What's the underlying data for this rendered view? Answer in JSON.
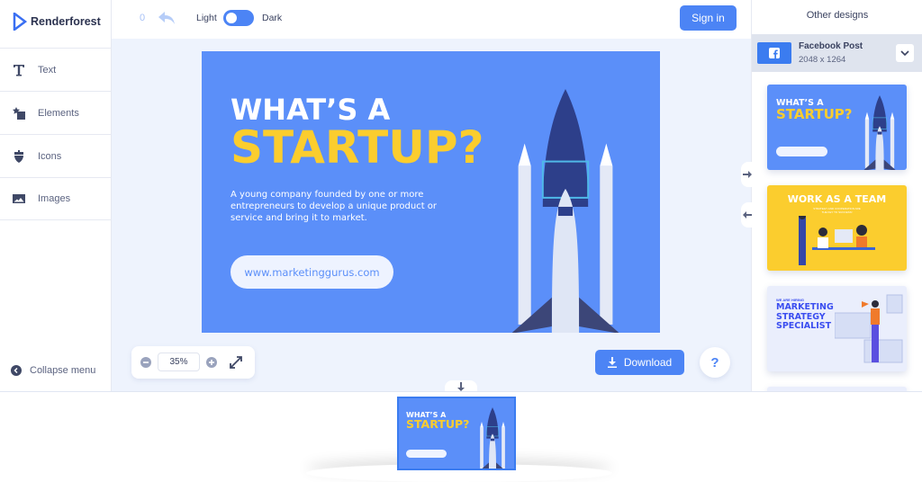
{
  "brand": {
    "name": "Renderforest",
    "accent": "#4c84f5"
  },
  "sidebar": {
    "items": [
      {
        "label": "Text",
        "icon": "text-icon"
      },
      {
        "label": "Elements",
        "icon": "elements-icon"
      },
      {
        "label": "Icons",
        "icon": "acorn-icon"
      },
      {
        "label": "Images",
        "icon": "image-icon"
      }
    ],
    "collapse": "Collapse menu"
  },
  "topbar": {
    "undo_count": "0",
    "light": "Light",
    "dark": "Dark",
    "sign_in": "Sign in"
  },
  "design": {
    "line1": "WHAT’S A",
    "line2": "STARTUP?",
    "body": "A young company founded by one or more entrepreneurs to develop a unique product or service and bring it to market.",
    "url": "www.marketinggurus.com",
    "bg": "#5b8ff9",
    "yellow": "#fbcd2e"
  },
  "zoom": {
    "value": "35%"
  },
  "download": "Download",
  "help": "?",
  "right_panel": {
    "title": "Other designs",
    "format": {
      "name": "Facebook Post",
      "size": "2048 x 1264"
    },
    "templates": [
      {
        "line1": "WHAT’S A",
        "line2": "STARTUP?"
      },
      {
        "title": "WORK AS A TEAM",
        "subtitle": "STRATEGY AND COOPERATION ARE THE KEY TO SUCCESS!"
      },
      {
        "kicker": "WE ARE HIRING",
        "title": "MARKETING STRATEGY SPECIALIST"
      }
    ]
  }
}
